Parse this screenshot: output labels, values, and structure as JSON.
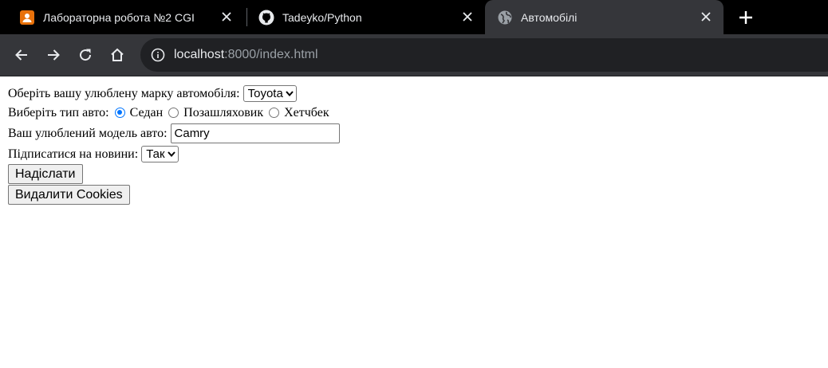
{
  "browser": {
    "tabs": [
      {
        "title": "Лабораторна робота №2 CGI",
        "icon": "user-badge-icon",
        "active": false
      },
      {
        "title": "Tadeyko/Python",
        "icon": "github-icon",
        "active": false
      },
      {
        "title": "Автомобілі",
        "icon": "globe-icon",
        "active": true
      }
    ],
    "address": {
      "host": "localhost",
      "rest": ":8000/index.html"
    },
    "colors": {
      "tabstrip": "#000000",
      "active_tab": "#35363a",
      "omnibox": "#202124",
      "favicon_orange": "#e8710a"
    }
  },
  "form": {
    "brand": {
      "label": "Оберіть вашу улюблену марку автомобіля:",
      "selected": "Toyota"
    },
    "type": {
      "label": "Виберіть тип авто:",
      "options": [
        {
          "label": "Седан",
          "checked": true
        },
        {
          "label": "Позашляховик",
          "checked": false
        },
        {
          "label": "Хетчбек",
          "checked": false
        }
      ]
    },
    "model": {
      "label": "Ваш улюблений модель авто:",
      "value": "Camry"
    },
    "subscribe": {
      "label": "Підписатися на новини:",
      "selected": "Так"
    },
    "submit_label": "Надіслати",
    "delete_cookies_label": "Видалити Cookies"
  }
}
